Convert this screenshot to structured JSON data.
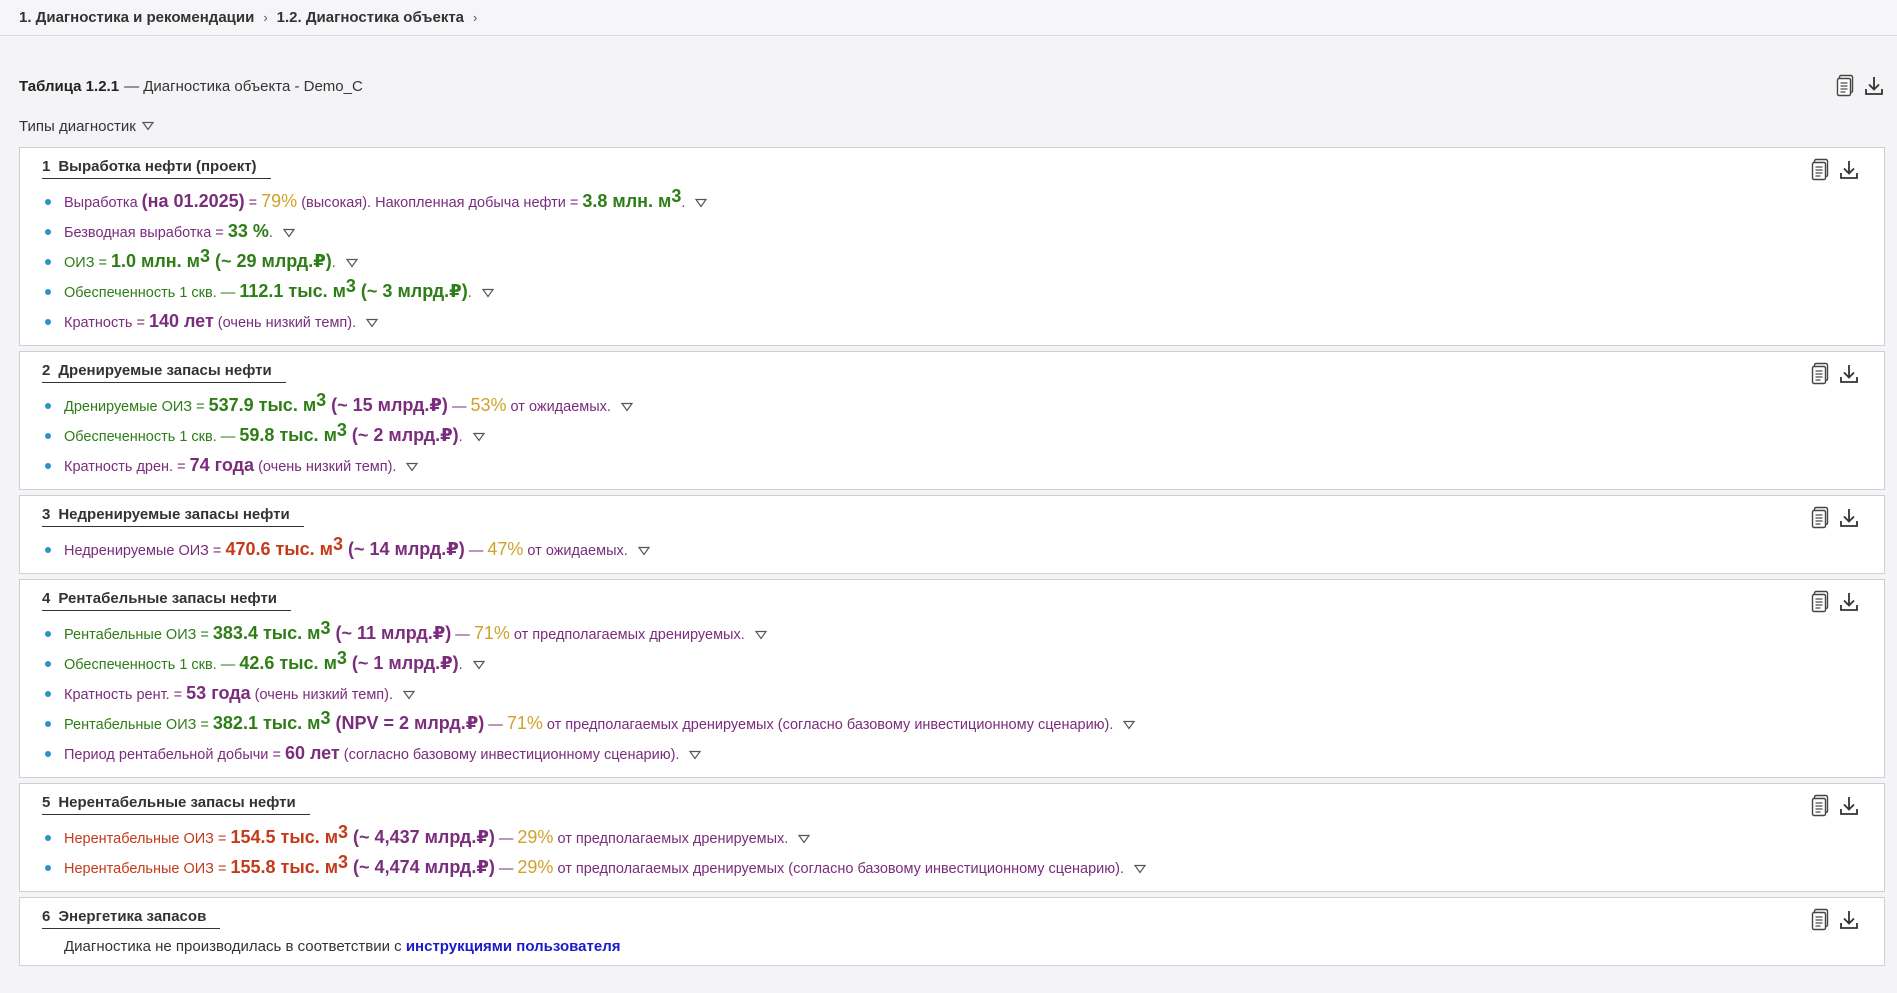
{
  "breadcrumb": {
    "items": [
      "1. Диагностика и рекомендации",
      "1.2. Диагностика объекта"
    ],
    "sep": "›"
  },
  "table": {
    "code": "Таблица 1.2.1",
    "title": "— Диагностика объекта - Demo_C"
  },
  "filter": {
    "label": "Типы диагностик"
  },
  "sections": [
    {
      "num": "1",
      "title": "Выработка нефти (проект)",
      "rows": [
        [
          "Выработка ",
          "(на 01.2025)",
          " = ",
          "79%",
          " (высокая). Накопленная добыча нефти = ",
          "3.8 млн. м",
          "3",
          "."
        ],
        [
          "Безводная выработка = ",
          "33 %",
          "."
        ],
        [
          "ОИЗ = ",
          "1.0 млн. м",
          "3",
          " (~ 29 млрд.₽)",
          "."
        ],
        [
          "Обеспеченность 1 скв. — ",
          "112.1 тыс. м",
          "3",
          " (~ 3 млрд.₽)",
          "."
        ],
        [
          "Кратность = ",
          "140 лет",
          " (очень низкий темп)."
        ]
      ]
    },
    {
      "num": "2",
      "title": "Дренируемые запасы нефти",
      "rows": [
        [
          "Дренируемые ОИЗ = ",
          "537.9 тыс. м",
          "3",
          " (~ 15 млрд.₽)",
          " — ",
          "53%",
          " от ожидаемых."
        ],
        [
          "Обеспеченность 1 скв. — ",
          "59.8 тыс. м",
          "3",
          " (~ 2 млрд.₽)",
          "."
        ],
        [
          "Кратность дрен. = ",
          "74 года",
          " (очень низкий темп)."
        ]
      ]
    },
    {
      "num": "3",
      "title": "Недренируемые запасы нефти",
      "rows": [
        [
          "Недренируемые ОИЗ = ",
          "470.6 тыс. м",
          "3",
          " (~ 14 млрд.₽)",
          " — ",
          "47%",
          " от ожидаемых."
        ]
      ]
    },
    {
      "num": "4",
      "title": "Рентабельные запасы нефти",
      "rows": [
        [
          "Рентабельные ОИЗ = ",
          "383.4 тыс. м",
          "3",
          " (~ 11 млрд.₽)",
          " — ",
          "71%",
          " от предполагаемых дренируемых."
        ],
        [
          "Обеспеченность 1 скв. — ",
          "42.6 тыс. м",
          "3",
          " (~ 1 млрд.₽)",
          "."
        ],
        [
          "Кратность рент. = ",
          "53 года",
          " (очень низкий темп)."
        ],
        [
          "Рентабельные ОИЗ = ",
          "382.1 тыс. м",
          "3",
          " (NPV = 2 млрд.₽)",
          " — ",
          "71%",
          " от предполагаемых дренируемых (согласно базовому инвестиционному сценарию)."
        ],
        [
          "Период рентабельной добычи = ",
          "60 лет",
          " (согласно базовому инвестиционному сценарию)."
        ]
      ]
    },
    {
      "num": "5",
      "title": "Нерентабельные запасы нефти",
      "rows": [
        [
          "Нерентабельные ОИЗ = ",
          "154.5 тыс. м",
          "3",
          " (~ 4,437 млрд.₽)",
          " — ",
          "29%",
          " от предполагаемых дренируемых."
        ],
        [
          "Нерентабельные ОИЗ = ",
          "155.8 тыс. м",
          "3",
          " (~ 4,474 млрд.₽)",
          " — ",
          "29%",
          " от предполагаемых дренируемых (согласно базовому инвестиционному сценарию)."
        ]
      ]
    },
    {
      "num": "6",
      "title": "Энергетика запасов",
      "note_prefix": "Диагностика не производилась в соответствии с ",
      "note_link": "инструкциями пользователя"
    }
  ],
  "colors": {
    "green": "#2e7d16",
    "purple": "#7a2d7c",
    "red": "#c43a1a",
    "yellow": "#d0a22a",
    "link": "#1a1ac8",
    "bullet": "#2a93c9"
  },
  "icons": [
    "copy-document-icon",
    "download-icon",
    "triangle-down-icon"
  ]
}
